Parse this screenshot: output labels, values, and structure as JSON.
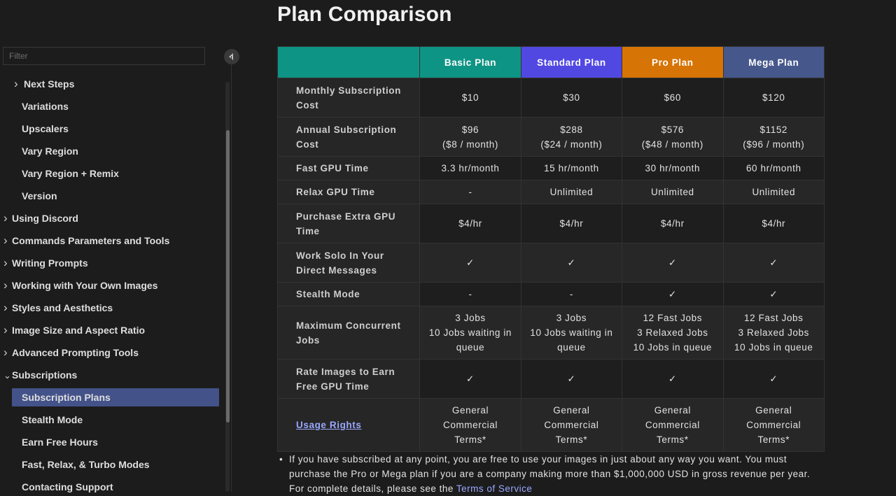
{
  "sidebar": {
    "filter_placeholder": "Filter",
    "items": [
      {
        "label": "Next Steps",
        "chevron": ">",
        "level": 1
      },
      {
        "label": "Variations",
        "chevron": "",
        "level": 1
      },
      {
        "label": "Upscalers",
        "chevron": "",
        "level": 1
      },
      {
        "label": "Vary Region",
        "chevron": "",
        "level": 1
      },
      {
        "label": "Vary Region + Remix",
        "chevron": "",
        "level": 1
      },
      {
        "label": "Version",
        "chevron": "",
        "level": 1
      },
      {
        "label": "Using Discord",
        "chevron": ">",
        "level": 0
      },
      {
        "label": "Commands Parameters and Tools",
        "chevron": ">",
        "level": 0
      },
      {
        "label": "Writing Prompts",
        "chevron": ">",
        "level": 0
      },
      {
        "label": "Working with Your Own Images",
        "chevron": ">",
        "level": 0
      },
      {
        "label": "Styles and Aesthetics",
        "chevron": ">",
        "level": 0
      },
      {
        "label": "Image Size and Aspect Ratio",
        "chevron": ">",
        "level": 0
      },
      {
        "label": "Advanced Prompting Tools",
        "chevron": ">",
        "level": 0
      },
      {
        "label": "Subscriptions",
        "chevron": "v",
        "level": 0
      },
      {
        "label": "Subscription Plans",
        "chevron": "",
        "level": 1,
        "selected": true
      },
      {
        "label": "Stealth Mode",
        "chevron": "",
        "level": 1
      },
      {
        "label": "Earn Free Hours",
        "chevron": "",
        "level": 1
      },
      {
        "label": "Fast, Relax, & Turbo Modes",
        "chevron": "",
        "level": 1
      },
      {
        "label": "Contacting Support",
        "chevron": "",
        "level": 1
      }
    ],
    "selected_color": "#435289"
  },
  "main": {
    "title": "Plan Comparison",
    "table": {
      "header_corner_color": "#0e9485",
      "plans": [
        {
          "name": "Basic Plan",
          "color": "#0e9485"
        },
        {
          "name": "Standard Plan",
          "color": "#5148e2"
        },
        {
          "name": "Pro Plan",
          "color": "#d67406"
        },
        {
          "name": "Mega Plan",
          "color": "#46578c"
        }
      ],
      "rows": [
        {
          "label": "Monthly Subscription Cost",
          "values": [
            "$10",
            "$30",
            "$60",
            "$120"
          ]
        },
        {
          "label": "Annual Subscription Cost",
          "values": [
            "$96\n($8 / month)",
            "$288\n($24 / month)",
            "$576\n($48 / month)",
            "$1152\n($96 / month)"
          ]
        },
        {
          "label": "Fast GPU Time",
          "values": [
            "3.3 hr/month",
            "15 hr/month",
            "30 hr/month",
            "60 hr/month"
          ]
        },
        {
          "label": "Relax GPU Time",
          "values": [
            "-",
            "Unlimited",
            "Unlimited",
            "Unlimited"
          ]
        },
        {
          "label": "Purchase Extra GPU Time",
          "values": [
            "$4/hr",
            "$4/hr",
            "$4/hr",
            "$4/hr"
          ]
        },
        {
          "label": "Work Solo In Your Direct Messages",
          "values": [
            "✓",
            "✓",
            "✓",
            "✓"
          ]
        },
        {
          "label": "Stealth Mode",
          "values": [
            "-",
            "-",
            "✓",
            "✓"
          ]
        },
        {
          "label": "Maximum Concurrent Jobs",
          "values": [
            "3 Jobs\n10 Jobs waiting in queue",
            "3 Jobs\n10 Jobs waiting in queue",
            "12 Fast Jobs\n3 Relaxed Jobs\n10 Jobs in queue",
            "12 Fast Jobs\n3 Relaxed Jobs\n10 Jobs in queue"
          ]
        },
        {
          "label": "Rate Images to Earn Free GPU Time",
          "values": [
            "✓",
            "✓",
            "✓",
            "✓"
          ]
        },
        {
          "label": "Usage Rights",
          "link": true,
          "values": [
            "General Commercial Terms*",
            "General Commercial Terms*",
            "General Commercial Terms*",
            "General Commercial Terms*"
          ]
        }
      ]
    },
    "note": {
      "text": "If you have subscribed at any point, you are free to use your images in just about any way you want. You must purchase the Pro or Mega plan if you are a company making more than $1,000,000 USD in gross revenue per year. For complete details, please see the ",
      "link_text": "Terms of Service"
    }
  }
}
